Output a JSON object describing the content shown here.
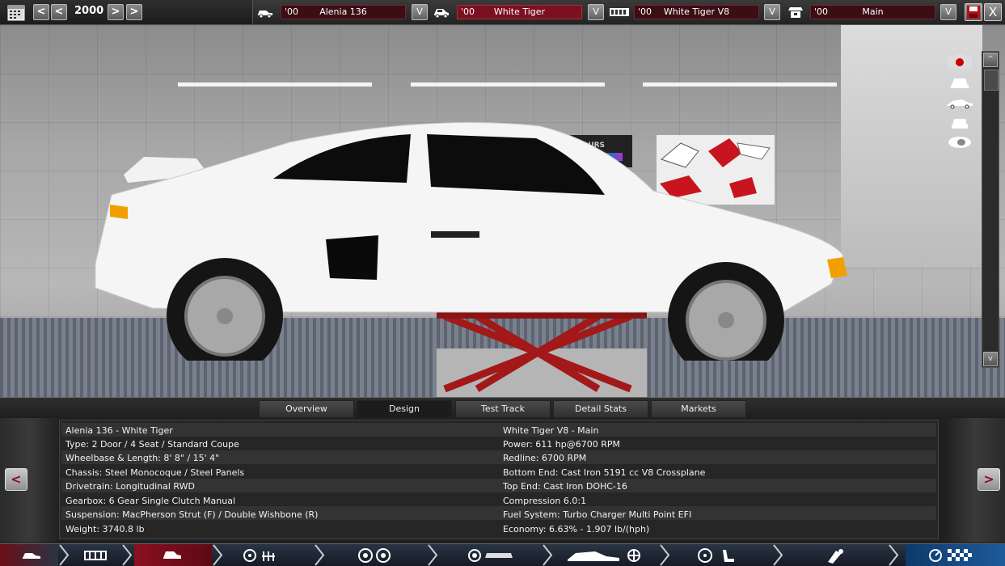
{
  "topbar": {
    "year": "2000",
    "prev_label": "<",
    "prev_fast_label": "<",
    "next_label": ">",
    "next_fast_label": ">",
    "selectors": [
      {
        "year": "'00",
        "name": "Alenia 136",
        "dropdown": "V",
        "icon": "car-model-icon",
        "active": false
      },
      {
        "year": "'00",
        "name": "White Tiger",
        "dropdown": "V",
        "icon": "car-trim-icon",
        "active": true
      },
      {
        "year": "'00",
        "name": "White Tiger V8",
        "dropdown": "V",
        "icon": "engine-family-icon",
        "active": false
      },
      {
        "year": "'00",
        "name": "Main",
        "dropdown": "V",
        "icon": "engine-variant-icon",
        "active": false
      }
    ],
    "close_label": "X"
  },
  "viewport": {
    "side_buttons": [
      "camera-icon",
      "front-view-icon",
      "side-view-icon",
      "rear-view-icon",
      "top-view-icon"
    ],
    "scroll_up": "^",
    "scroll_down": "v"
  },
  "tabs": [
    {
      "label": "Overview",
      "active": false
    },
    {
      "label": "Design",
      "active": true
    },
    {
      "label": "Test Track",
      "active": false
    },
    {
      "label": "Detail Stats",
      "active": false
    },
    {
      "label": "Markets",
      "active": false
    }
  ],
  "info": {
    "left": [
      "Alenia 136 - White Tiger",
      "Type: 2 Door / 4 Seat / Standard Coupe",
      "Wheelbase & Length: 8' 8\" / 15' 4\"",
      "Chassis: Steel Monocoque / Steel Panels",
      "Drivetrain: Longitudinal RWD",
      "Gearbox: 6 Gear Single Clutch Manual",
      "Suspension: MacPherson Strut (F) / Double Wishbone (R)",
      "Weight: 3740.8 lb"
    ],
    "right": [
      "White Tiger V8 - Main",
      "Power: 611 hp@6700 RPM",
      "Redline: 6700 RPM",
      "Bottom End: Cast Iron 5191 cc V8 Crossplane",
      "Top End: Cast Iron DOHC-16",
      "Compression 6.0:1",
      "Fuel System: Turbo Charger Multi Point EFI",
      "Economy: 6.63% - 1.907 lb/(hph)"
    ],
    "prev_label": "<",
    "next_label": ">"
  },
  "bottom_nav": [
    {
      "icon": "car-body-icon",
      "active": false
    },
    {
      "icon": "chassis-icon",
      "active": false
    },
    {
      "icon": "car-design-icon",
      "active": true
    },
    {
      "icon": "suspension-icon",
      "active": false
    },
    {
      "icon": "wheels-icon",
      "active": false
    },
    {
      "icon": "brakes-icon",
      "active": false
    },
    {
      "icon": "aero-cooling-icon",
      "active": false
    },
    {
      "icon": "interior-steering-icon",
      "active": false
    },
    {
      "icon": "tuning-icon",
      "active": false
    },
    {
      "icon": "finish-icon",
      "active": false
    }
  ],
  "poster_text": "COLOURS"
}
